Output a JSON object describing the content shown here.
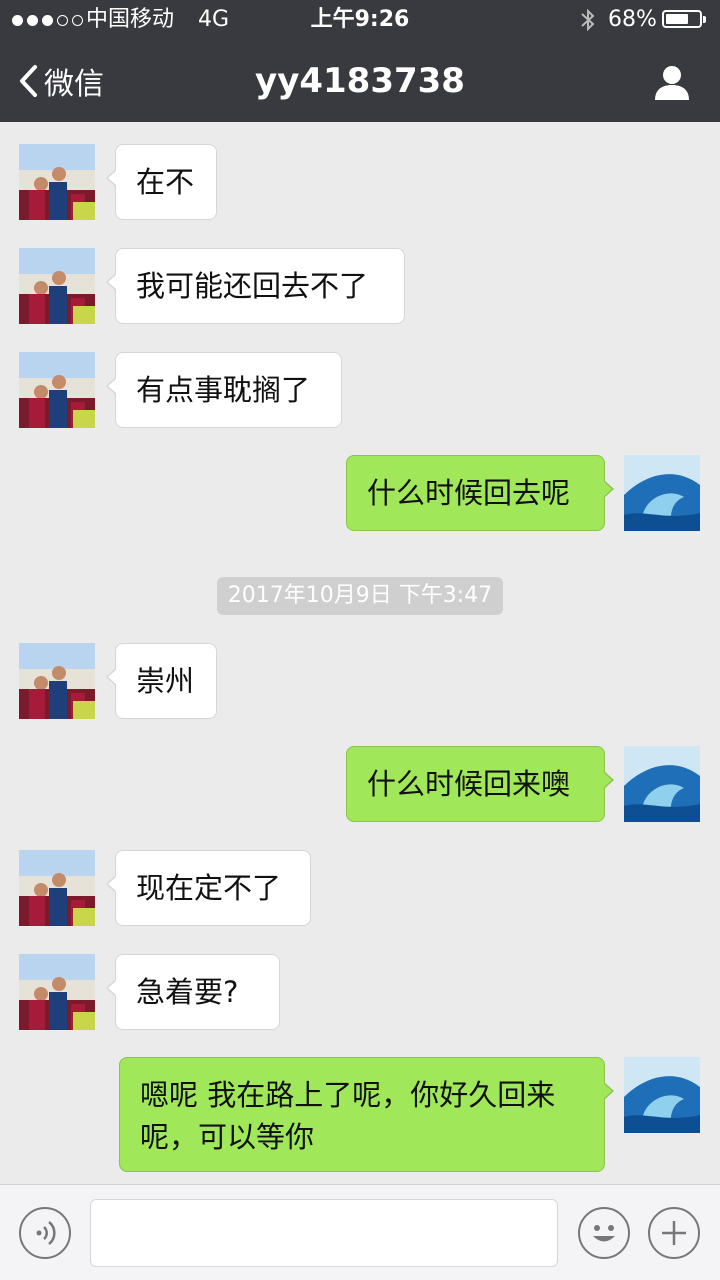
{
  "status_bar": {
    "carrier": "中国移动",
    "network": "4G",
    "time": "上午9:26",
    "battery_percent": "68%",
    "battery_level": 0.68
  },
  "nav": {
    "back_label": "微信",
    "title": "yy4183738"
  },
  "messages": [
    {
      "from": "other",
      "text": "在不"
    },
    {
      "from": "other",
      "text": "我可能还回去不了"
    },
    {
      "from": "other",
      "text": "有点事耽搁了"
    },
    {
      "from": "me",
      "text": "什么时候回去呢"
    },
    {
      "from": "other",
      "text": "崇州"
    },
    {
      "from": "me",
      "text": "什么时候回来噢"
    },
    {
      "from": "other",
      "text": "现在定不了"
    },
    {
      "from": "other",
      "text": "急着要?"
    },
    {
      "from": "me",
      "text": "嗯呢 我在路上了呢，你好久回来呢，可以等你"
    }
  ],
  "timestamp": "2017年10月9日 下午3:47",
  "colors": {
    "nav_bg": "#393a3f",
    "chat_bg": "#ebebeb",
    "bubble_out": "#a0e75a",
    "bubble_in": "#ffffff"
  }
}
